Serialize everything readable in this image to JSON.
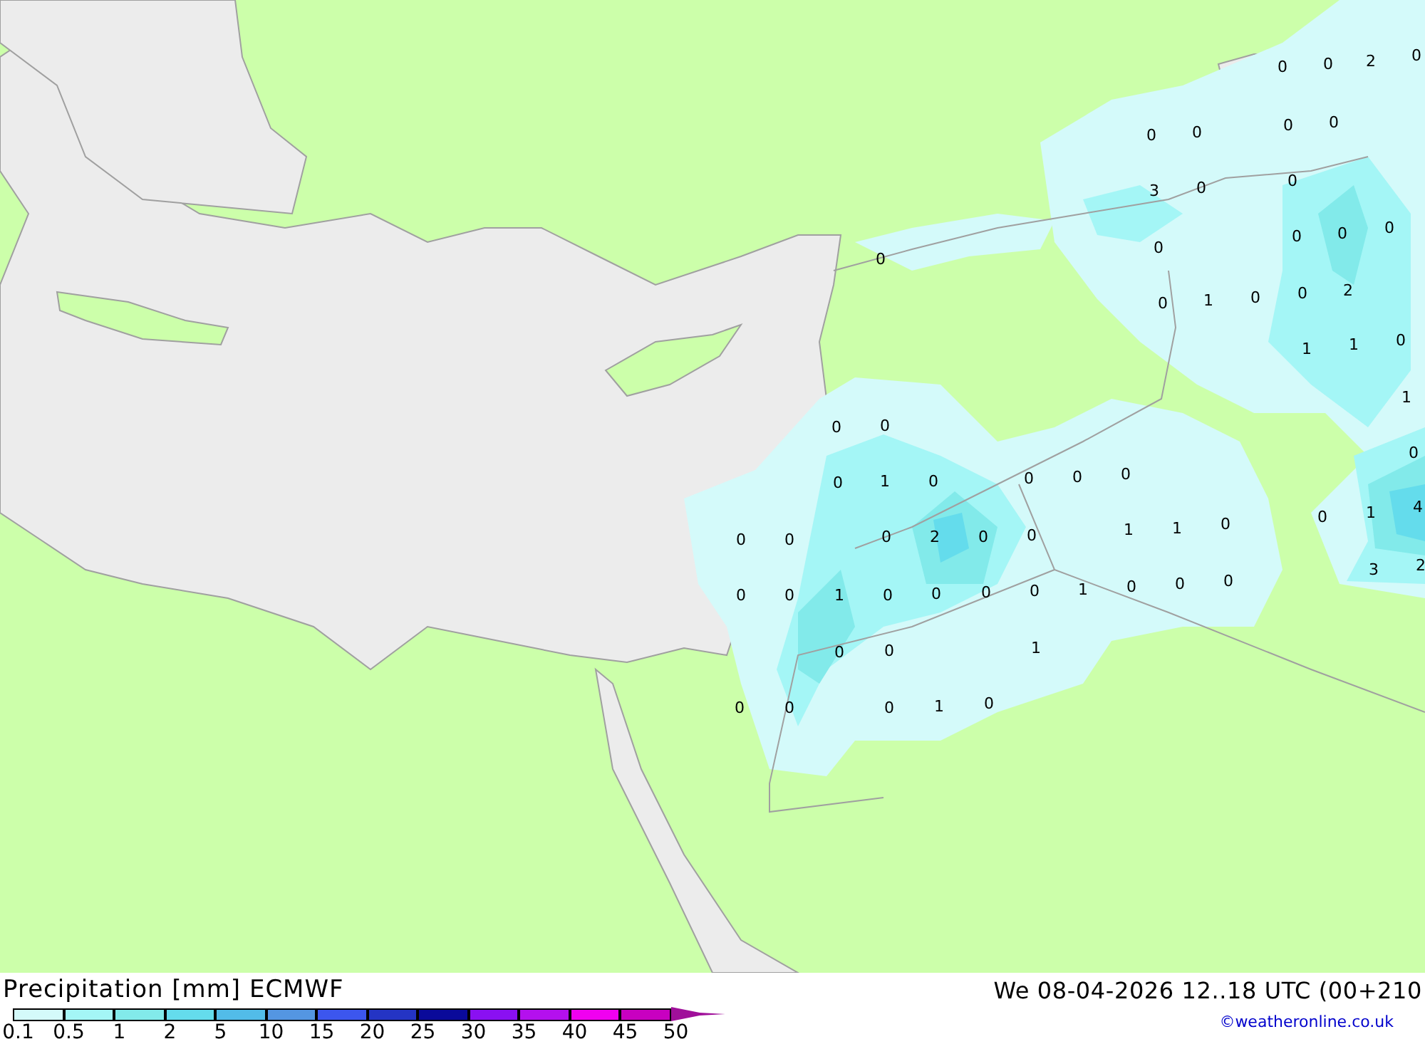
{
  "map": {
    "labels": [
      "0",
      "0",
      "2",
      "0",
      "0",
      "0",
      "0",
      "0",
      "3",
      "0",
      "0",
      "0",
      "0",
      "0",
      "0",
      "0",
      "0",
      "1",
      "0",
      "0",
      "2",
      "1",
      "1",
      "0",
      "1",
      "0",
      "0",
      "0",
      "0",
      "1",
      "0",
      "0",
      "0",
      "0",
      "0",
      "1",
      "4",
      "0",
      "0",
      "0",
      "2",
      "0",
      "0",
      "1",
      "1",
      "0",
      "3",
      "2",
      "0",
      "0",
      "1",
      "0",
      "0",
      "0",
      "0",
      "1",
      "0",
      "0",
      "0",
      "0",
      "0",
      "1",
      "0",
      "0",
      "0",
      "1",
      "0"
    ]
  },
  "footer": {
    "title": "Precipitation [mm] ECMWF",
    "datetime": "We 08-04-2026 12..18 UTC (00+210",
    "legend": {
      "swatches": [
        {
          "color": "#d4fafa"
        },
        {
          "color": "#a4f6f6"
        },
        {
          "color": "#82eaea"
        },
        {
          "color": "#64dcec"
        },
        {
          "color": "#52bce8"
        },
        {
          "color": "#5496e2"
        },
        {
          "color": "#3c56ee"
        },
        {
          "color": "#2434c4"
        },
        {
          "color": "#0a0a9a"
        },
        {
          "color": "#8a10f2"
        },
        {
          "color": "#b410ee"
        },
        {
          "color": "#f000f0"
        },
        {
          "color": "#c800c0"
        }
      ],
      "arrow": {
        "color": "#a0109a"
      },
      "ticks": [
        "0.1",
        "0.5",
        "1",
        "2",
        "5",
        "10",
        "15",
        "20",
        "25",
        "30",
        "35",
        "40",
        "45",
        "50"
      ]
    },
    "credit": "©weatheronline.co.uk"
  }
}
